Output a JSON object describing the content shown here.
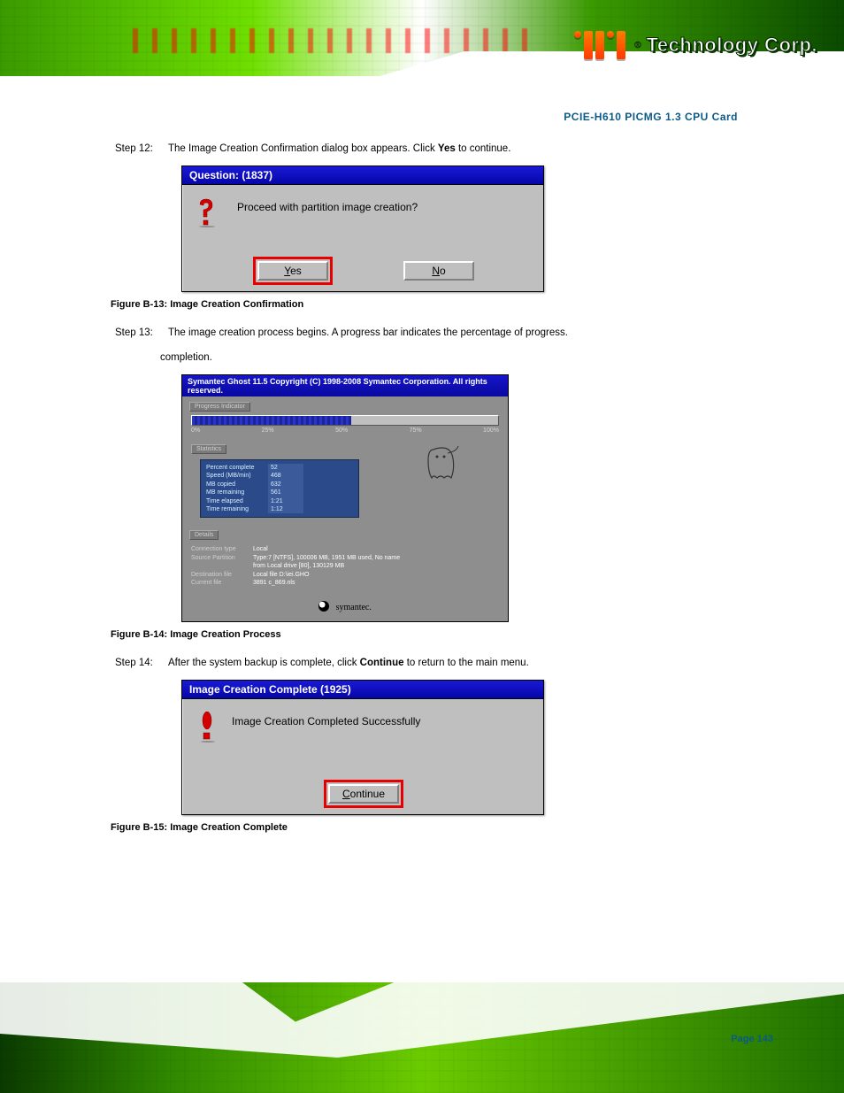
{
  "header": {
    "brand_registered": "®",
    "brand_name": "Technology Corp."
  },
  "product_title": "PCIE-H610 PICMG 1.3 CPU Card",
  "steps": {
    "s12": {
      "num": "Step 12:",
      "text_prefix": "The Image Creation Confirmation dialog box appears. Click ",
      "bold": "Yes",
      "text_suffix": " to continue."
    },
    "f44_cap": "Figure B-13: Image Creation Confirmation",
    "s13": {
      "num": "Step 13:",
      "text": "The image creation process begins. A progress bar indicates the percentage of progress.",
      "text_indent": "completion."
    },
    "f45_cap": "Figure B-14: Image Creation Process",
    "s14": {
      "num": "Step 14:",
      "text_prefix": "After the system backup is complete, click ",
      "bold": "Continue",
      "text_suffix": " to return to the main menu."
    },
    "f46_cap": "Figure B-15: Image Creation Complete"
  },
  "dialog1": {
    "title": "Question: (1837)",
    "message": "Proceed with partition image creation?",
    "yes": "Yes",
    "no": "No"
  },
  "ghost": {
    "title": "Symantec Ghost 11.5   Copyright (C) 1998-2008 Symantec Corporation. All rights reserved.",
    "progress_label": "Progress Indicator",
    "ticks": [
      "0%",
      "25%",
      "50%",
      "75%",
      "100%"
    ],
    "percent_fill": "52",
    "stats_label": "Statistics",
    "stats": [
      {
        "k": "Percent complete",
        "v": "52"
      },
      {
        "k": "Speed (MB/min)",
        "v": "468"
      },
      {
        "k": "MB copied",
        "v": "632"
      },
      {
        "k": "MB remaining",
        "v": "561"
      },
      {
        "k": "Time elapsed",
        "v": "1:21"
      },
      {
        "k": "Time remaining",
        "v": "1:12"
      }
    ],
    "details_label": "Details",
    "details": [
      {
        "k": "Connection type",
        "v": "Local"
      },
      {
        "k": "Source Partition",
        "v": "Type:7 [NTFS], 100006 MB, 1951 MB used, No name"
      },
      {
        "k": "",
        "v": "from Local drive [80], 130129 MB"
      },
      {
        "k": "Destination file",
        "v": "Local file D:\\iei.GHO"
      },
      {
        "k": "Current file",
        "v": "3891 c_869.nls"
      }
    ],
    "footer": "symantec."
  },
  "dialog3": {
    "title": "Image Creation Complete (1925)",
    "message": "Image Creation Completed Successfully",
    "continue": "Continue"
  },
  "page_label": "Page 143"
}
